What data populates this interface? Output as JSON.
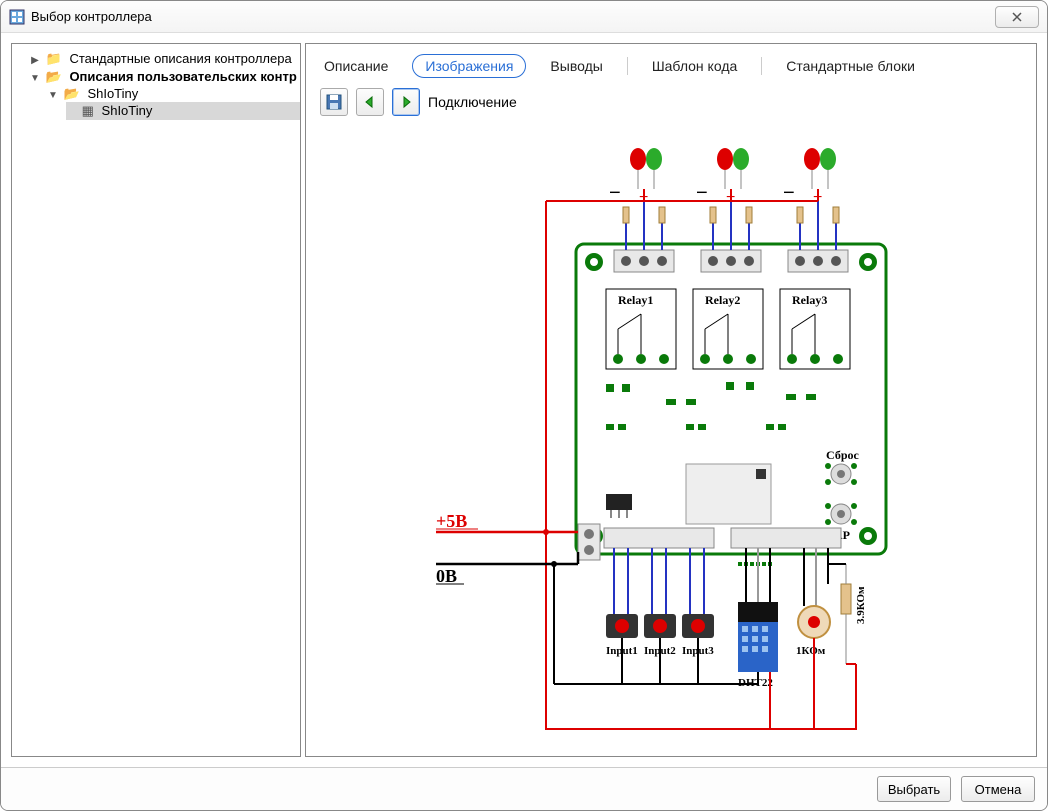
{
  "window": {
    "title": "Выбор контроллера"
  },
  "tree": {
    "node1": {
      "label": "Стандартные описания контроллера"
    },
    "node2": {
      "label": "Описания пользовательских контр"
    },
    "node2_1": {
      "label": "ShIoTiny"
    },
    "node2_1_1": {
      "label": "ShIoTiny"
    }
  },
  "tabs": {
    "t1": "Описание",
    "t2": "Изображения",
    "t3": "Выводы",
    "t4": "Шаблон кода",
    "t5": "Стандартные блоки"
  },
  "toolbar": {
    "label": "Подключение"
  },
  "board": {
    "relay1": "Relay1",
    "relay2": "Relay2",
    "relay3": "Relay3",
    "reset": "Сброс",
    "ap": "AP",
    "plus5v": "+5В",
    "zero": "0В",
    "input1": "Input1",
    "input2": "Input2",
    "input3": "Input3",
    "dht22": "DHT22",
    "r39k": "3.9КОм",
    "r1k": "1КОм"
  },
  "footer": {
    "select": "Выбрать",
    "cancel": "Отмена"
  }
}
